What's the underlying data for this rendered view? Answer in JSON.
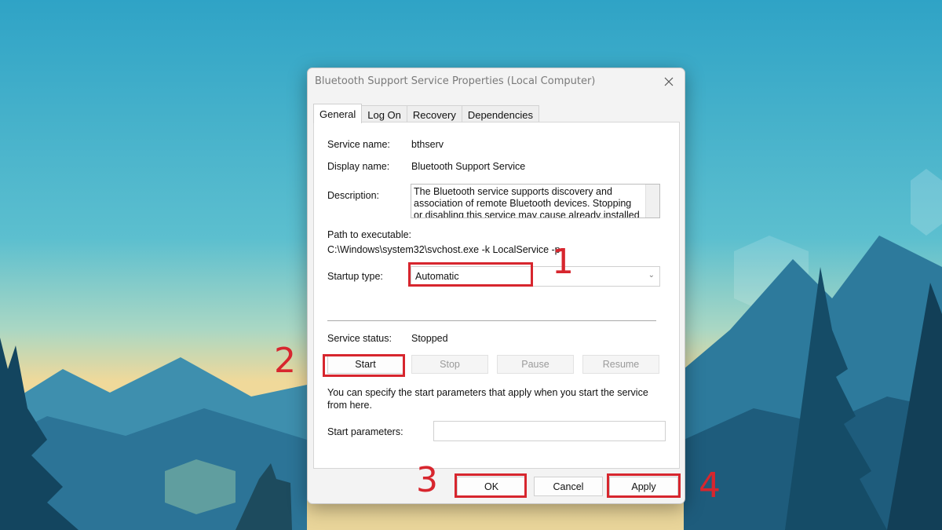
{
  "dialog": {
    "title": "Bluetooth Support Service Properties (Local Computer)",
    "close_icon": "close-icon",
    "tabs": [
      {
        "label": "General",
        "active": true
      },
      {
        "label": "Log On",
        "active": false
      },
      {
        "label": "Recovery",
        "active": false
      },
      {
        "label": "Dependencies",
        "active": false
      }
    ],
    "general": {
      "service_name_label": "Service name:",
      "service_name_value": "bthserv",
      "display_name_label": "Display name:",
      "display_name_value": "Bluetooth Support Service",
      "description_label": "Description:",
      "description_value": "The Bluetooth service supports discovery and association of remote Bluetooth devices.  Stopping or disabling this service may cause already installed",
      "path_label": "Path to executable:",
      "path_value": "C:\\Windows\\system32\\svchost.exe -k LocalService -p",
      "startup_type_label": "Startup type:",
      "startup_type_value": "Automatic",
      "service_status_label": "Service status:",
      "service_status_value": "Stopped",
      "buttons": {
        "start": "Start",
        "stop": "Stop",
        "pause": "Pause",
        "resume": "Resume"
      },
      "note": "You can specify the start parameters that apply when you start the service from here.",
      "start_params_label": "Start parameters:",
      "start_params_value": ""
    },
    "footer": {
      "ok": "OK",
      "cancel": "Cancel",
      "apply": "Apply"
    }
  },
  "annotations": {
    "color": "#d7262e",
    "steps": [
      "1",
      "2",
      "3",
      "4"
    ]
  }
}
